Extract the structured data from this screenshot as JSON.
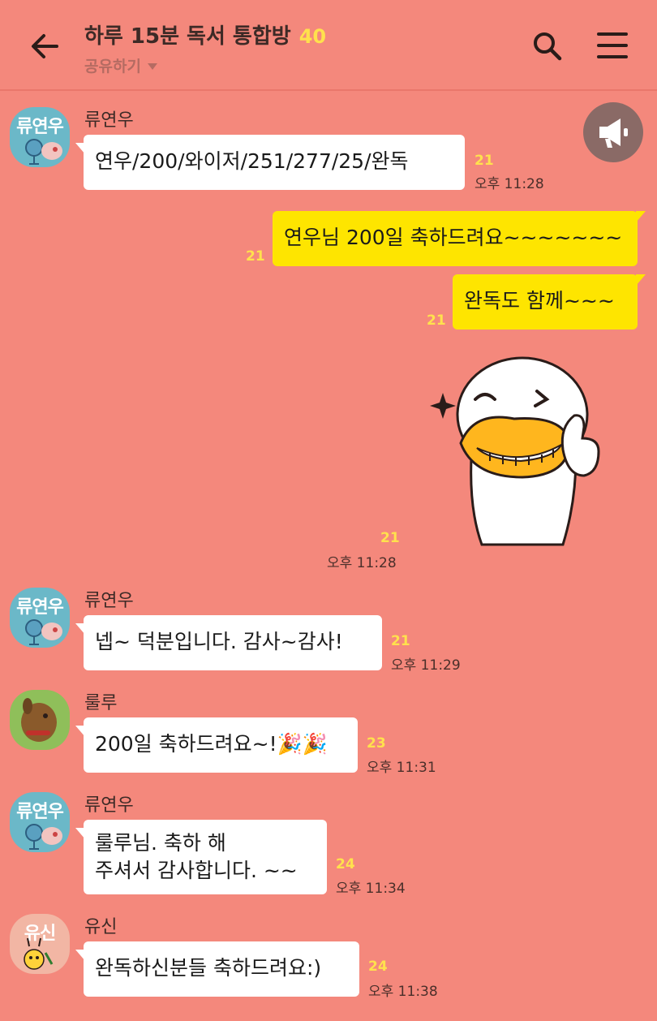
{
  "header": {
    "title": "하루 15분 독서 통합방",
    "member_count": "40",
    "share_label": "공유하기"
  },
  "icons": {
    "back": "arrow-left-icon",
    "search": "search-icon",
    "menu": "hamburger-menu-icon",
    "notice": "megaphone-icon"
  },
  "colors": {
    "background": "#f4887c",
    "my_bubble": "#fee500",
    "other_bubble": "#ffffff",
    "unread": "#ffe14d"
  },
  "messages": [
    {
      "sender": "류연우",
      "avatar_label": "류연우",
      "text": "연우/200/와이저/251/277/25/완독",
      "unread": "21",
      "time": "오후 11:28"
    },
    {
      "sender": "me",
      "text": "연우님 200일 축하드려요~~~~~~~",
      "unread": "21"
    },
    {
      "sender": "me",
      "text": "완독도 함께~~~",
      "unread": "21"
    },
    {
      "sender": "me",
      "sticker": "thumbs-up-duck-sticker",
      "unread": "21",
      "time": "오후 11:28"
    },
    {
      "sender": "류연우",
      "avatar_label": "류연우",
      "text": "넵~ 덕분입니다.  감사~감사!",
      "unread": "21",
      "time": "오후 11:29"
    },
    {
      "sender": "룰루",
      "text": "200일 축하드려요~!🎉🎉",
      "unread": "23",
      "time": "오후 11:31"
    },
    {
      "sender": "류연우",
      "avatar_label": "류연우",
      "text": "룰루님. 축하 해\n주셔서 감사합니다. ~~",
      "unread": "24",
      "time": "오후 11:34"
    },
    {
      "sender": "유신",
      "avatar_label": "유신",
      "text": "완독하신분들 축하드려요:)",
      "unread": "24",
      "time": "오후 11:38"
    }
  ]
}
